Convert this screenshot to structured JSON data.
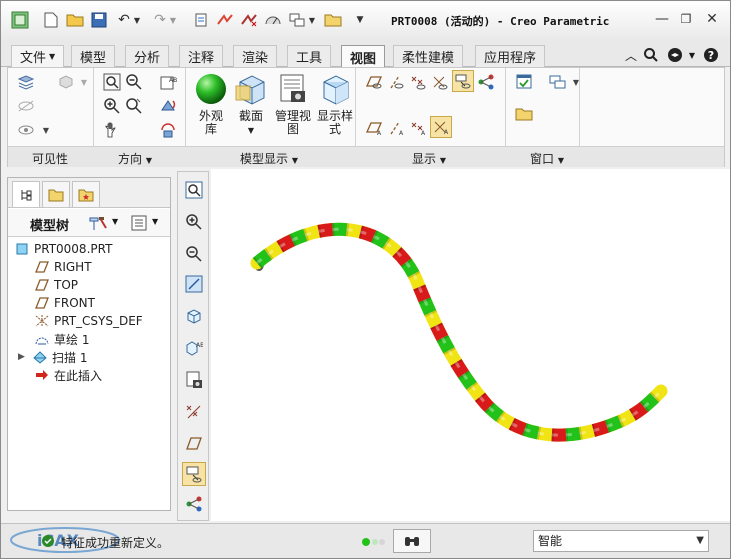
{
  "window": {
    "title": "PRT0008 (活动的) - Creo Parametric"
  },
  "tabs": [
    {
      "label": "文件"
    },
    {
      "label": "模型"
    },
    {
      "label": "分析"
    },
    {
      "label": "注释"
    },
    {
      "label": "渲染"
    },
    {
      "label": "工具"
    },
    {
      "label": "视图"
    },
    {
      "label": "柔性建模"
    },
    {
      "label": "应用程序"
    }
  ],
  "ribbon": {
    "groups": [
      {
        "label": "可见性"
      },
      {
        "label": "方向"
      },
      {
        "label": "模型显示"
      },
      {
        "label": "显示"
      },
      {
        "label": "窗口"
      }
    ],
    "big_buttons": [
      {
        "label": "外观\n库"
      },
      {
        "label": "截面"
      },
      {
        "label": "管理视\n图"
      },
      {
        "label": "显示样\n式"
      }
    ]
  },
  "model_tree": {
    "title": "模型树",
    "items": [
      {
        "label": "PRT0008.PRT"
      },
      {
        "label": "RIGHT"
      },
      {
        "label": "TOP"
      },
      {
        "label": "FRONT"
      },
      {
        "label": "PRT_CSYS_DEF"
      },
      {
        "label": "草绘 1"
      },
      {
        "label": "扫描 1"
      },
      {
        "label": "在此插入"
      }
    ]
  },
  "status": {
    "message": "特征成功重新定义。",
    "selection_filter": "智能"
  },
  "colors": {
    "rope_green": "#22c21b",
    "rope_red": "#d81a1a",
    "rope_yellow": "#f0e414",
    "selected": "#f6e3a5"
  }
}
